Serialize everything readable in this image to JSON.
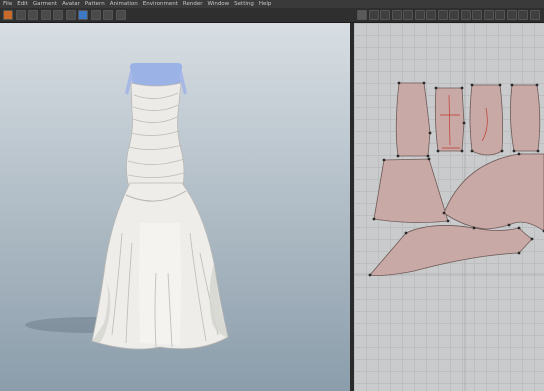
{
  "menu": {
    "items": [
      "File",
      "Edit",
      "Garment",
      "Avatar",
      "Pattern",
      "Animation",
      "Environment",
      "Render",
      "Window",
      "Setting",
      "Help"
    ]
  },
  "toolbar3d": {
    "tools": [
      "simulate-icon",
      "texture-icon",
      "play-icon",
      "select-icon",
      "move-icon",
      "record-icon",
      "avatar-icon",
      "pointer-icon",
      "fold-icon",
      "pin-icon"
    ]
  },
  "toolbar2d": {
    "tools": [
      "select-icon",
      "transform-icon",
      "edit-point-icon",
      "curve-icon",
      "polygon-icon",
      "rectangle-icon",
      "internal-line-icon",
      "dart-icon",
      "segment-sewing-icon",
      "free-sewing-icon",
      "check-sewing-icon",
      "fold-icon",
      "trace-icon",
      "notch-icon",
      "texture-icon",
      "arrangement-icon"
    ]
  },
  "colors": {
    "pattern_fill": "#c9a9a6",
    "pattern_stroke": "#6e5a58",
    "garment": "#ecebe8",
    "avatar_top": "#9bb2e6",
    "point": "#2a2a2a",
    "internal_line": "#c0392b"
  }
}
